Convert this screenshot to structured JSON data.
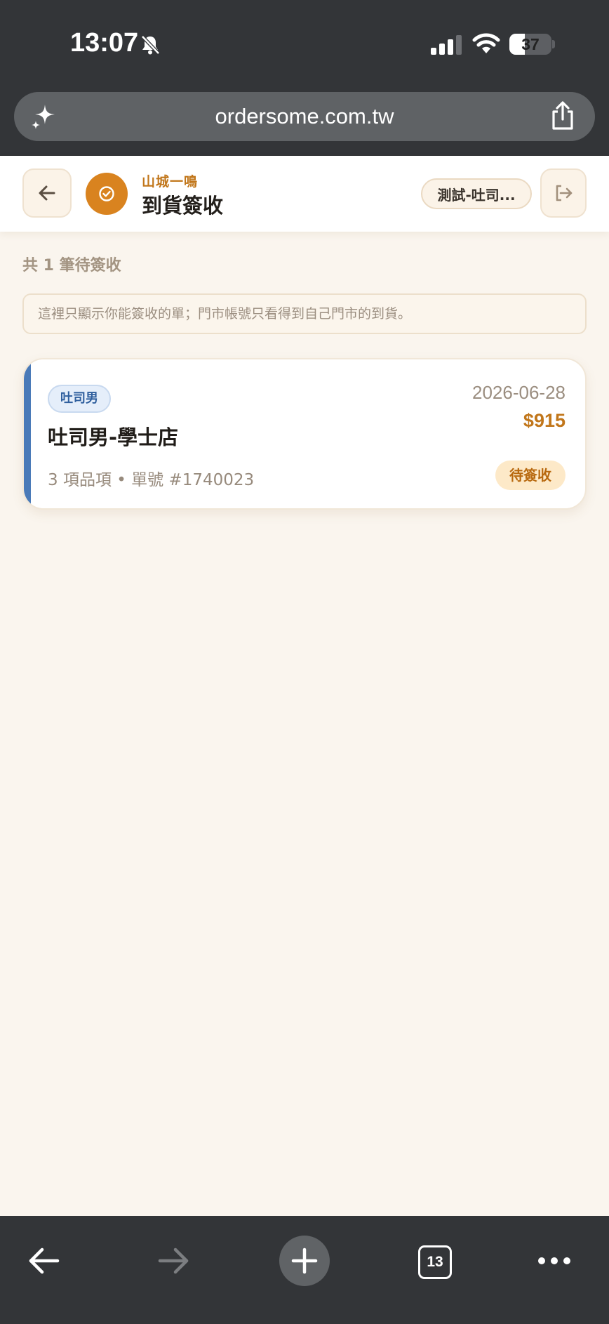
{
  "status_bar": {
    "time": "13:07",
    "battery_level": "37",
    "battery_fraction": 0.37,
    "icons": [
      "bell-slash-icon",
      "cellular-signal-icon",
      "wifi-icon",
      "battery-icon"
    ]
  },
  "browser": {
    "url": "ordersome.com.tw",
    "tab_count": "13",
    "icons": [
      "sparkle-icon",
      "share-icon",
      "back-arrow-icon",
      "forward-arrow-icon",
      "plus-icon",
      "tabs-icon",
      "more-icon"
    ]
  },
  "header": {
    "brand": "山城一鳴",
    "title": "到貨簽收",
    "store_selector": "測試-吐司...",
    "icons": [
      "back-arrow-icon",
      "check-badge-icon",
      "logout-icon"
    ]
  },
  "main": {
    "pending_count_label": "共 1 筆待簽收",
    "notice": "這裡只顯示你能簽收的單；門市帳號只看得到自己門市的到貨。",
    "orders": [
      {
        "brand_tag": "吐司男",
        "store_name": "吐司男-學士店",
        "meta": "3 項品項 • 單號 #1740023",
        "date": "2026-06-28",
        "total": "$915",
        "status": "待簽收"
      }
    ]
  },
  "colors": {
    "accent": "#d9831f",
    "card_stripe": "#4a7ab8",
    "status_bg": "#fde9c8",
    "page_bg": "#faf5ee",
    "chrome_bg": "#333538"
  }
}
